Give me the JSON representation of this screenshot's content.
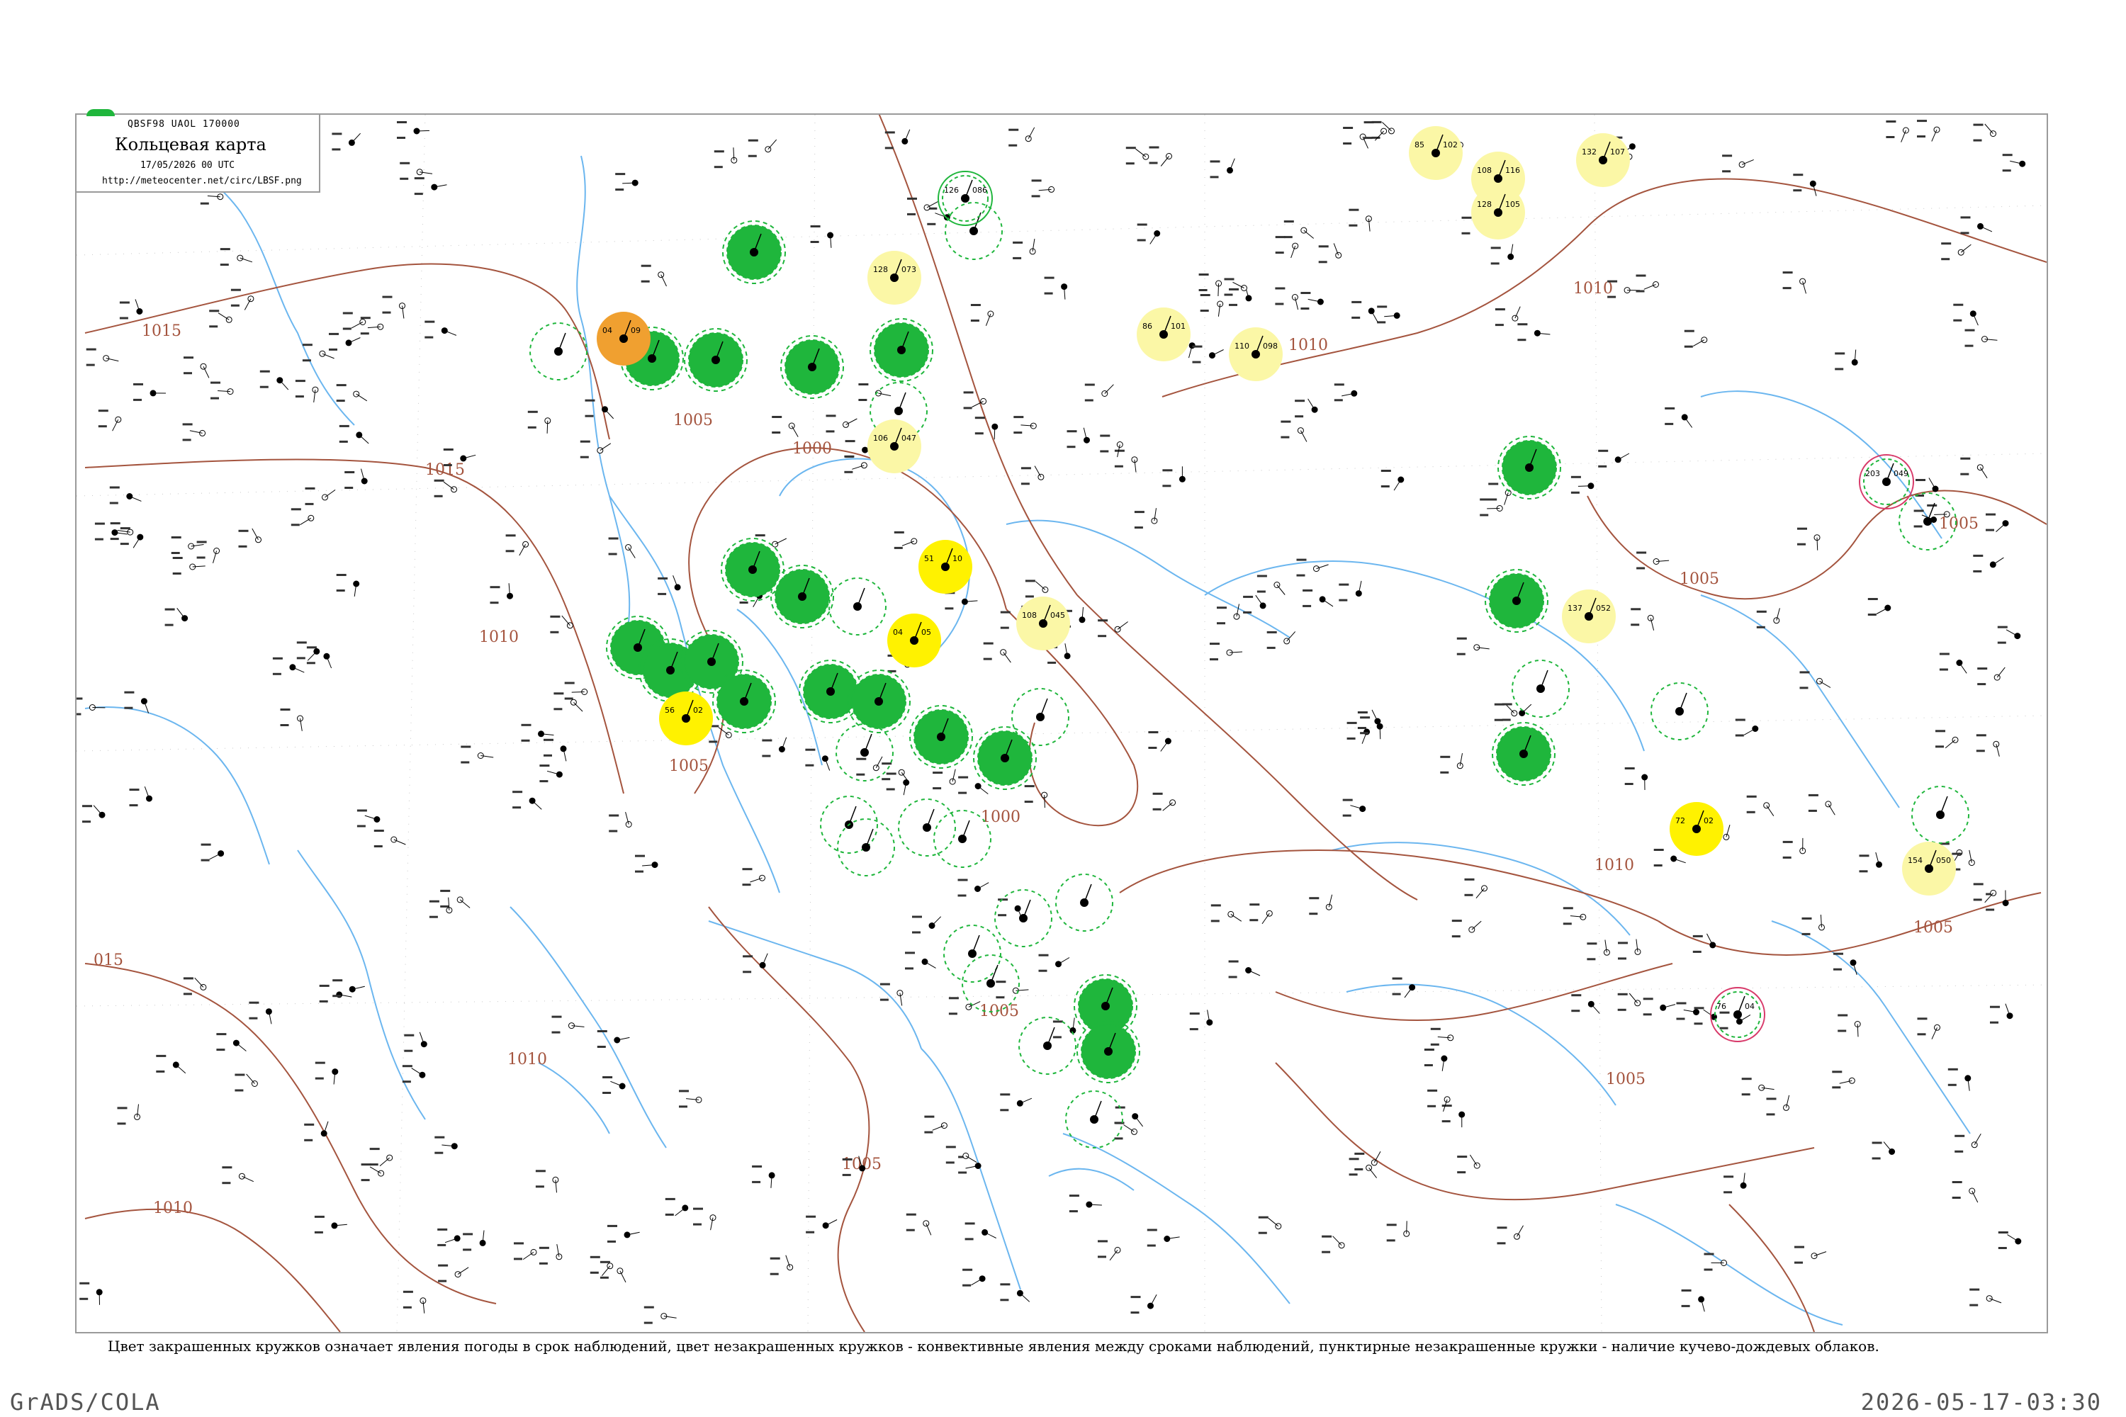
{
  "header": {
    "code": "QBSF98  UAOL  170000",
    "title": "Кольцевая карта",
    "datetime": "17/05/2026 00 UTC",
    "url": "http://meteocenter.net/circ/LBSF.png"
  },
  "caption": "Цвет закрашенных кружков означает явления погоды в срок наблюдений, цвет незакрашенных кружков - конвективные явления между сроками наблюдений, пунктирные незакрашенные кружки - наличие кучево-дождевых облаков.",
  "footer": {
    "left": "GrADS/COLA",
    "right": "2026-05-17-03:30"
  },
  "isobar_labels": [
    "1015",
    "1015",
    "1010",
    "1005",
    "1000",
    "1005",
    "1000",
    "1005",
    "1010",
    "1005",
    "1005",
    "1010",
    "1010",
    "1010",
    "015",
    "1005",
    "1005",
    "1005",
    "1010"
  ],
  "colors": {
    "isobar": "#a4543e",
    "water": "#6bb6ef",
    "green": "#1fb63c",
    "yellow": "#fff200",
    "light_yellow": "#fbf7a6",
    "orange": "#f0a030",
    "magenta": "#d83a6a",
    "frame": "#9a9a9a"
  },
  "stations": [
    {
      "p": "126",
      "t": "086",
      "kind": "ring-green"
    },
    {
      "p": "128",
      "t": "073",
      "kind": "light-yellow"
    },
    {
      "p": "106",
      "t": "047",
      "kind": "light-yellow"
    },
    {
      "p": "85",
      "t": "102",
      "kind": "light-yellow"
    },
    {
      "p": "108",
      "t": "116",
      "kind": "light-yellow"
    },
    {
      "p": "128",
      "t": "105",
      "kind": "light-yellow"
    },
    {
      "p": "132",
      "t": "107",
      "kind": "light-yellow"
    },
    {
      "p": "86",
      "t": "101",
      "kind": "light-yellow"
    },
    {
      "p": "110",
      "t": "098",
      "kind": "light-yellow"
    },
    {
      "p": "51",
      "t": "10",
      "kind": "yellow"
    },
    {
      "p": "108",
      "t": "045",
      "kind": "light-yellow"
    },
    {
      "p": "04",
      "t": "05",
      "kind": "yellow"
    },
    {
      "p": "56",
      "t": "02",
      "kind": "yellow"
    },
    {
      "p": "72",
      "t": "02",
      "kind": "yellow"
    },
    {
      "p": "137",
      "t": "052",
      "kind": "light-yellow"
    },
    {
      "p": "154",
      "t": "050",
      "kind": "light-yellow"
    },
    {
      "p": "04",
      "t": "09",
      "kind": "orange"
    },
    {
      "p": "203",
      "t": "049",
      "kind": "ring-magenta"
    },
    {
      "p": "76",
      "t": "04",
      "kind": "ring-magenta"
    }
  ]
}
